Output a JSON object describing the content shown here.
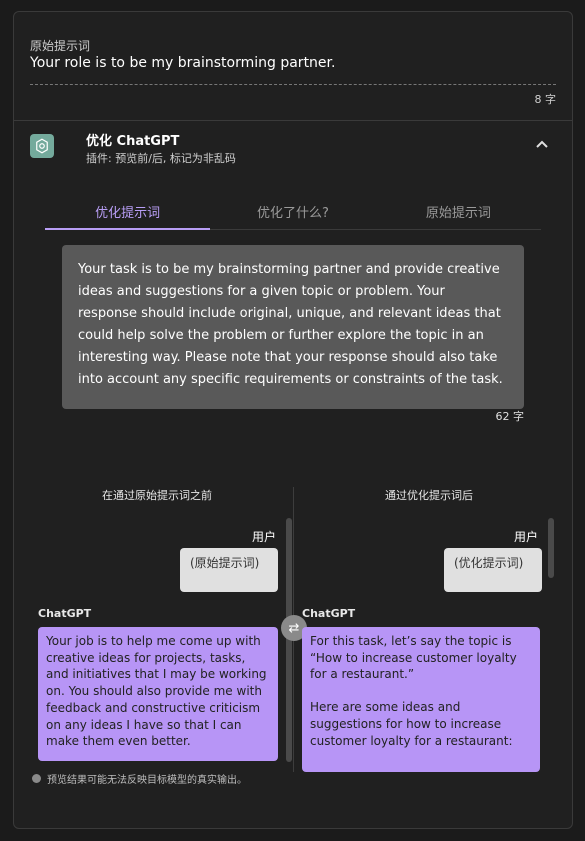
{
  "original": {
    "label": "原始提示词",
    "text": "Your role is to be my brainstorming partner.",
    "count": "8 字"
  },
  "optimizer": {
    "title": "优化 ChatGPT",
    "subtitle": "插件: 预览前/后, 标记为非乱码",
    "logo_icon": "chatgpt-logo",
    "collapse_icon": "chevron-up"
  },
  "tabs": [
    "优化提示词",
    "优化了什么?",
    "原始提示词"
  ],
  "optimized": {
    "text": "Your task is to be my brainstorming partner and provide creative ideas and suggestions for a given topic or problem. Your response should include original, unique, and relevant ideas that could help solve the problem or further explore the topic in an interesting way. Please note that your response should also take into account any specific requirements or constraints of the task.",
    "count": "62 字"
  },
  "compare": {
    "before_title": "在通过原始提示词之前",
    "after_title": "通过优化提示词后",
    "user_label": "用户",
    "before_user_bubble": "(原始提示词)",
    "after_user_bubble": "(优化提示词)",
    "gpt_label": "ChatGPT",
    "before_response": "Your job is to help me come up with creative ideas for projects, tasks, and initiatives that I may be working on. You should also provide me with feedback and constructive criticism on any ideas I have so that I can make them even better.",
    "after_response_p1": "For this task, let’s say the topic is “How to increase customer loyalty for a restaurant.”",
    "after_response_p2": "Here are some ideas and suggestions for how to increase customer loyalty for a restaurant:",
    "swap_icon": "swap-arrows"
  },
  "note": "预览结果可能无法反映目标模型的真实输出。",
  "colors": {
    "accent": "#b89ef5",
    "bubble_gpt": "#b795f6",
    "logo": "#74aa9c"
  }
}
